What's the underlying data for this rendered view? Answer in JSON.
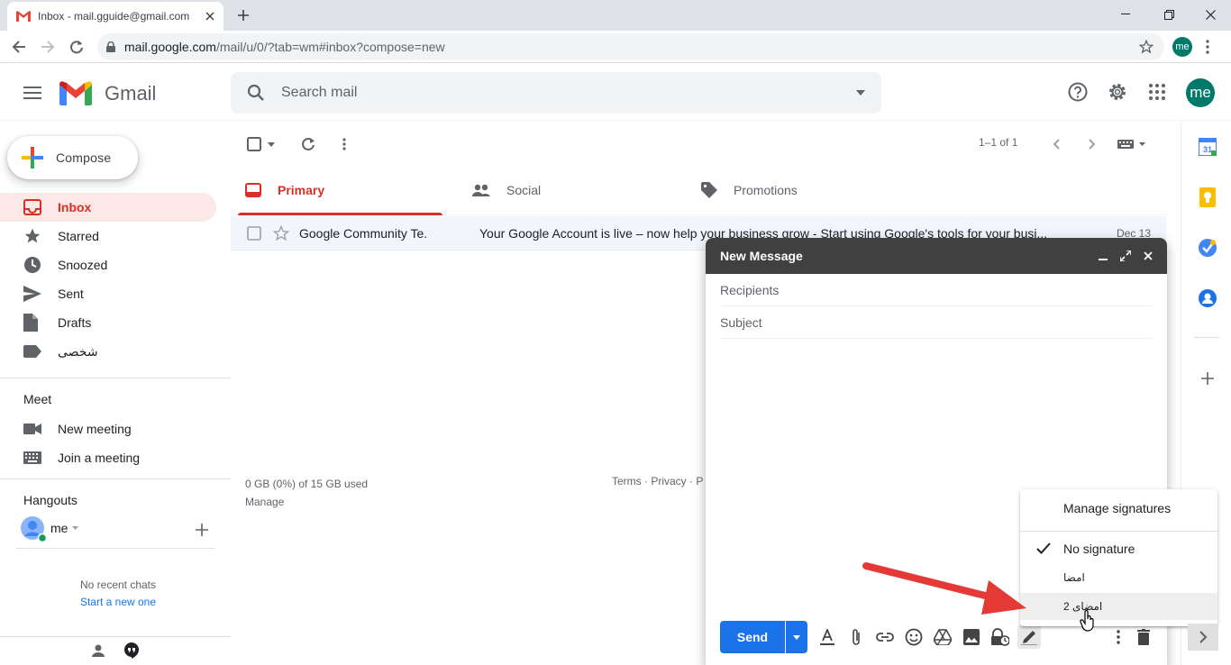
{
  "browser": {
    "tab_title": "Inbox - mail.gguide@gmail.com",
    "url_host": "mail.google.com",
    "url_path": "/mail/u/0/?tab=wm#inbox?compose=new",
    "profile": "me"
  },
  "header": {
    "product": "Gmail",
    "search_placeholder": "Search mail",
    "avatar": "me"
  },
  "sidebar": {
    "compose_label": "Compose",
    "items": [
      {
        "label": "Inbox",
        "icon": "inbox-icon",
        "active": true
      },
      {
        "label": "Starred",
        "icon": "star-icon"
      },
      {
        "label": "Snoozed",
        "icon": "clock-icon"
      },
      {
        "label": "Sent",
        "icon": "send-icon"
      },
      {
        "label": "Drafts",
        "icon": "draft-icon"
      },
      {
        "label": "شخصی",
        "icon": "label-icon"
      }
    ],
    "meet": {
      "heading": "Meet",
      "new_meeting": "New meeting",
      "join_meeting": "Join a meeting"
    },
    "hangouts": {
      "heading": "Hangouts",
      "user": "me",
      "no_chats": "No recent chats",
      "start_new": "Start a new one"
    }
  },
  "main": {
    "pager": "1–1 of 1",
    "tabs": [
      {
        "label": "Primary",
        "active": true
      },
      {
        "label": "Social"
      },
      {
        "label": "Promotions"
      }
    ],
    "rows": [
      {
        "sender": "Google Community Te.",
        "subject": "Your Google Account is live – now help your business grow - Start using Google's tools for your busi...",
        "date": "Dec 13"
      }
    ],
    "storage": "0 GB (0%) of 15 GB used",
    "manage": "Manage",
    "footer_links": "Terms · Privacy · P"
  },
  "compose": {
    "title": "New Message",
    "recipients_placeholder": "Recipients",
    "subject_placeholder": "Subject",
    "send_label": "Send"
  },
  "signature_menu": {
    "manage": "Manage signatures",
    "no_signature": "No signature",
    "sig1": "امضا",
    "sig2": "امضای 2"
  },
  "colors": {
    "accent_red": "#d93025",
    "send_blue": "#1a73e8",
    "compose_header": "#404040",
    "annotation_arrow": "#e53935"
  }
}
